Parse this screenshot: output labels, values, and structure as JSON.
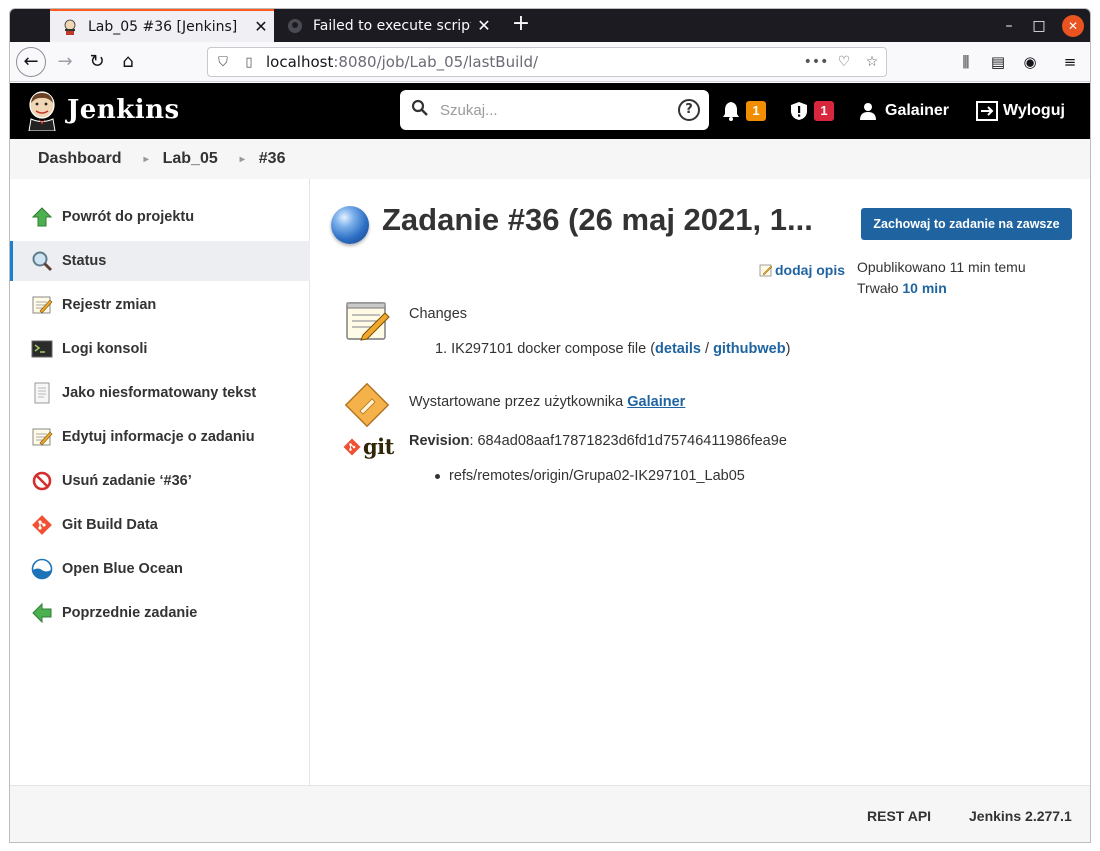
{
  "browser": {
    "tabs": [
      {
        "title": "Lab_05 #36 [Jenkins]",
        "active": true
      },
      {
        "title": "Failed to execute script d",
        "active": false
      }
    ],
    "url": {
      "host": "localhost",
      "path": ":8080/job/Lab_05/lastBuild/"
    },
    "url_menu": "•••"
  },
  "header": {
    "title": "Jenkins",
    "search_placeholder": "Szukaj...",
    "help": "?",
    "notifications_count": "1",
    "security_count": "1",
    "user": "Galainer",
    "logout": "Wyloguj"
  },
  "breadcrumb": [
    "Dashboard",
    "Lab_05",
    "#36"
  ],
  "sidebar": {
    "items": [
      {
        "label": "Powrót do projektu",
        "icon": "up-arrow-icon"
      },
      {
        "label": "Status",
        "icon": "magnifier-icon"
      },
      {
        "label": "Rejestr zmian",
        "icon": "notepad-icon"
      },
      {
        "label": "Logi konsoli",
        "icon": "terminal-icon"
      },
      {
        "label": "Jako niesformatowany tekst",
        "icon": "document-icon"
      },
      {
        "label": "Edytuj informacje o zadaniu",
        "icon": "notepad-edit-icon"
      },
      {
        "label": "Usuń zadanie ‘#36’",
        "icon": "no-entry-icon"
      },
      {
        "label": "Git Build Data",
        "icon": "git-icon"
      },
      {
        "label": "Open Blue Ocean",
        "icon": "blue-ocean-icon"
      },
      {
        "label": "Poprzednie zadanie",
        "icon": "left-arrow-icon"
      }
    ]
  },
  "main": {
    "title": "Zadanie #36 (26 maj 2021, 1...",
    "keep_button": "Zachowaj to zadanie na zawsze",
    "add_description": "dodaj opis",
    "published": "Opublikowano 11 min temu",
    "duration_label": "Trwało",
    "duration_value": "10 min",
    "changes_title": "Changes",
    "change": {
      "number": "1.",
      "text": "IK297101 docker compose file (",
      "details": "details",
      "sep": " / ",
      "githubweb": "githubweb",
      "close": ")"
    },
    "started_by_text": "Wystartowane przez użytkownika",
    "started_by_user": "Galainer",
    "revision_label": "Revision",
    "revision_hash": ": 684ad08aaf17871823d6fd1d75746411986fea9e",
    "ref": "refs/remotes/origin/Grupa02-IK297101_Lab05",
    "git_text": "git"
  },
  "footer": {
    "rest_api": "REST API",
    "version": "Jenkins 2.277.1"
  },
  "colors": {
    "accent": "#1f64a1",
    "header_bg": "#000000",
    "badge_orange": "#f28c00",
    "badge_red": "#d8263d"
  }
}
